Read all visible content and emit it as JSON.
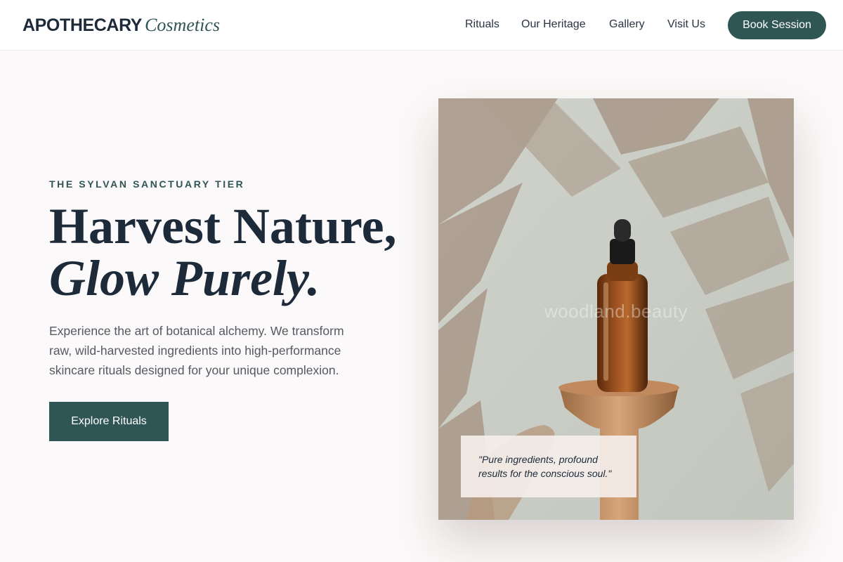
{
  "header": {
    "logo_main": "APOTHECARY",
    "logo_sub": "Cosmetics",
    "nav": [
      "Rituals",
      "Our Heritage",
      "Gallery",
      "Visit Us"
    ],
    "cta_label": "Book Session"
  },
  "hero": {
    "eyebrow": "THE SYLVAN SANCTUARY TIER",
    "headline_line1": "Harvest Nature,",
    "headline_line2": "Glow Purely.",
    "description": "Experience the art of botanical alchemy. We transform raw, wild-harvested ingredients into high-performance skincare rituals designed for your unique complexion.",
    "button_label": "Explore Rituals"
  },
  "image": {
    "watermark": "woodland.beauty",
    "quote": "\"Pure ingredients, profound results for the conscious soul.\""
  },
  "colors": {
    "accent": "#2f5555",
    "heading": "#1d2a3a",
    "background": "#fbf9f9"
  }
}
